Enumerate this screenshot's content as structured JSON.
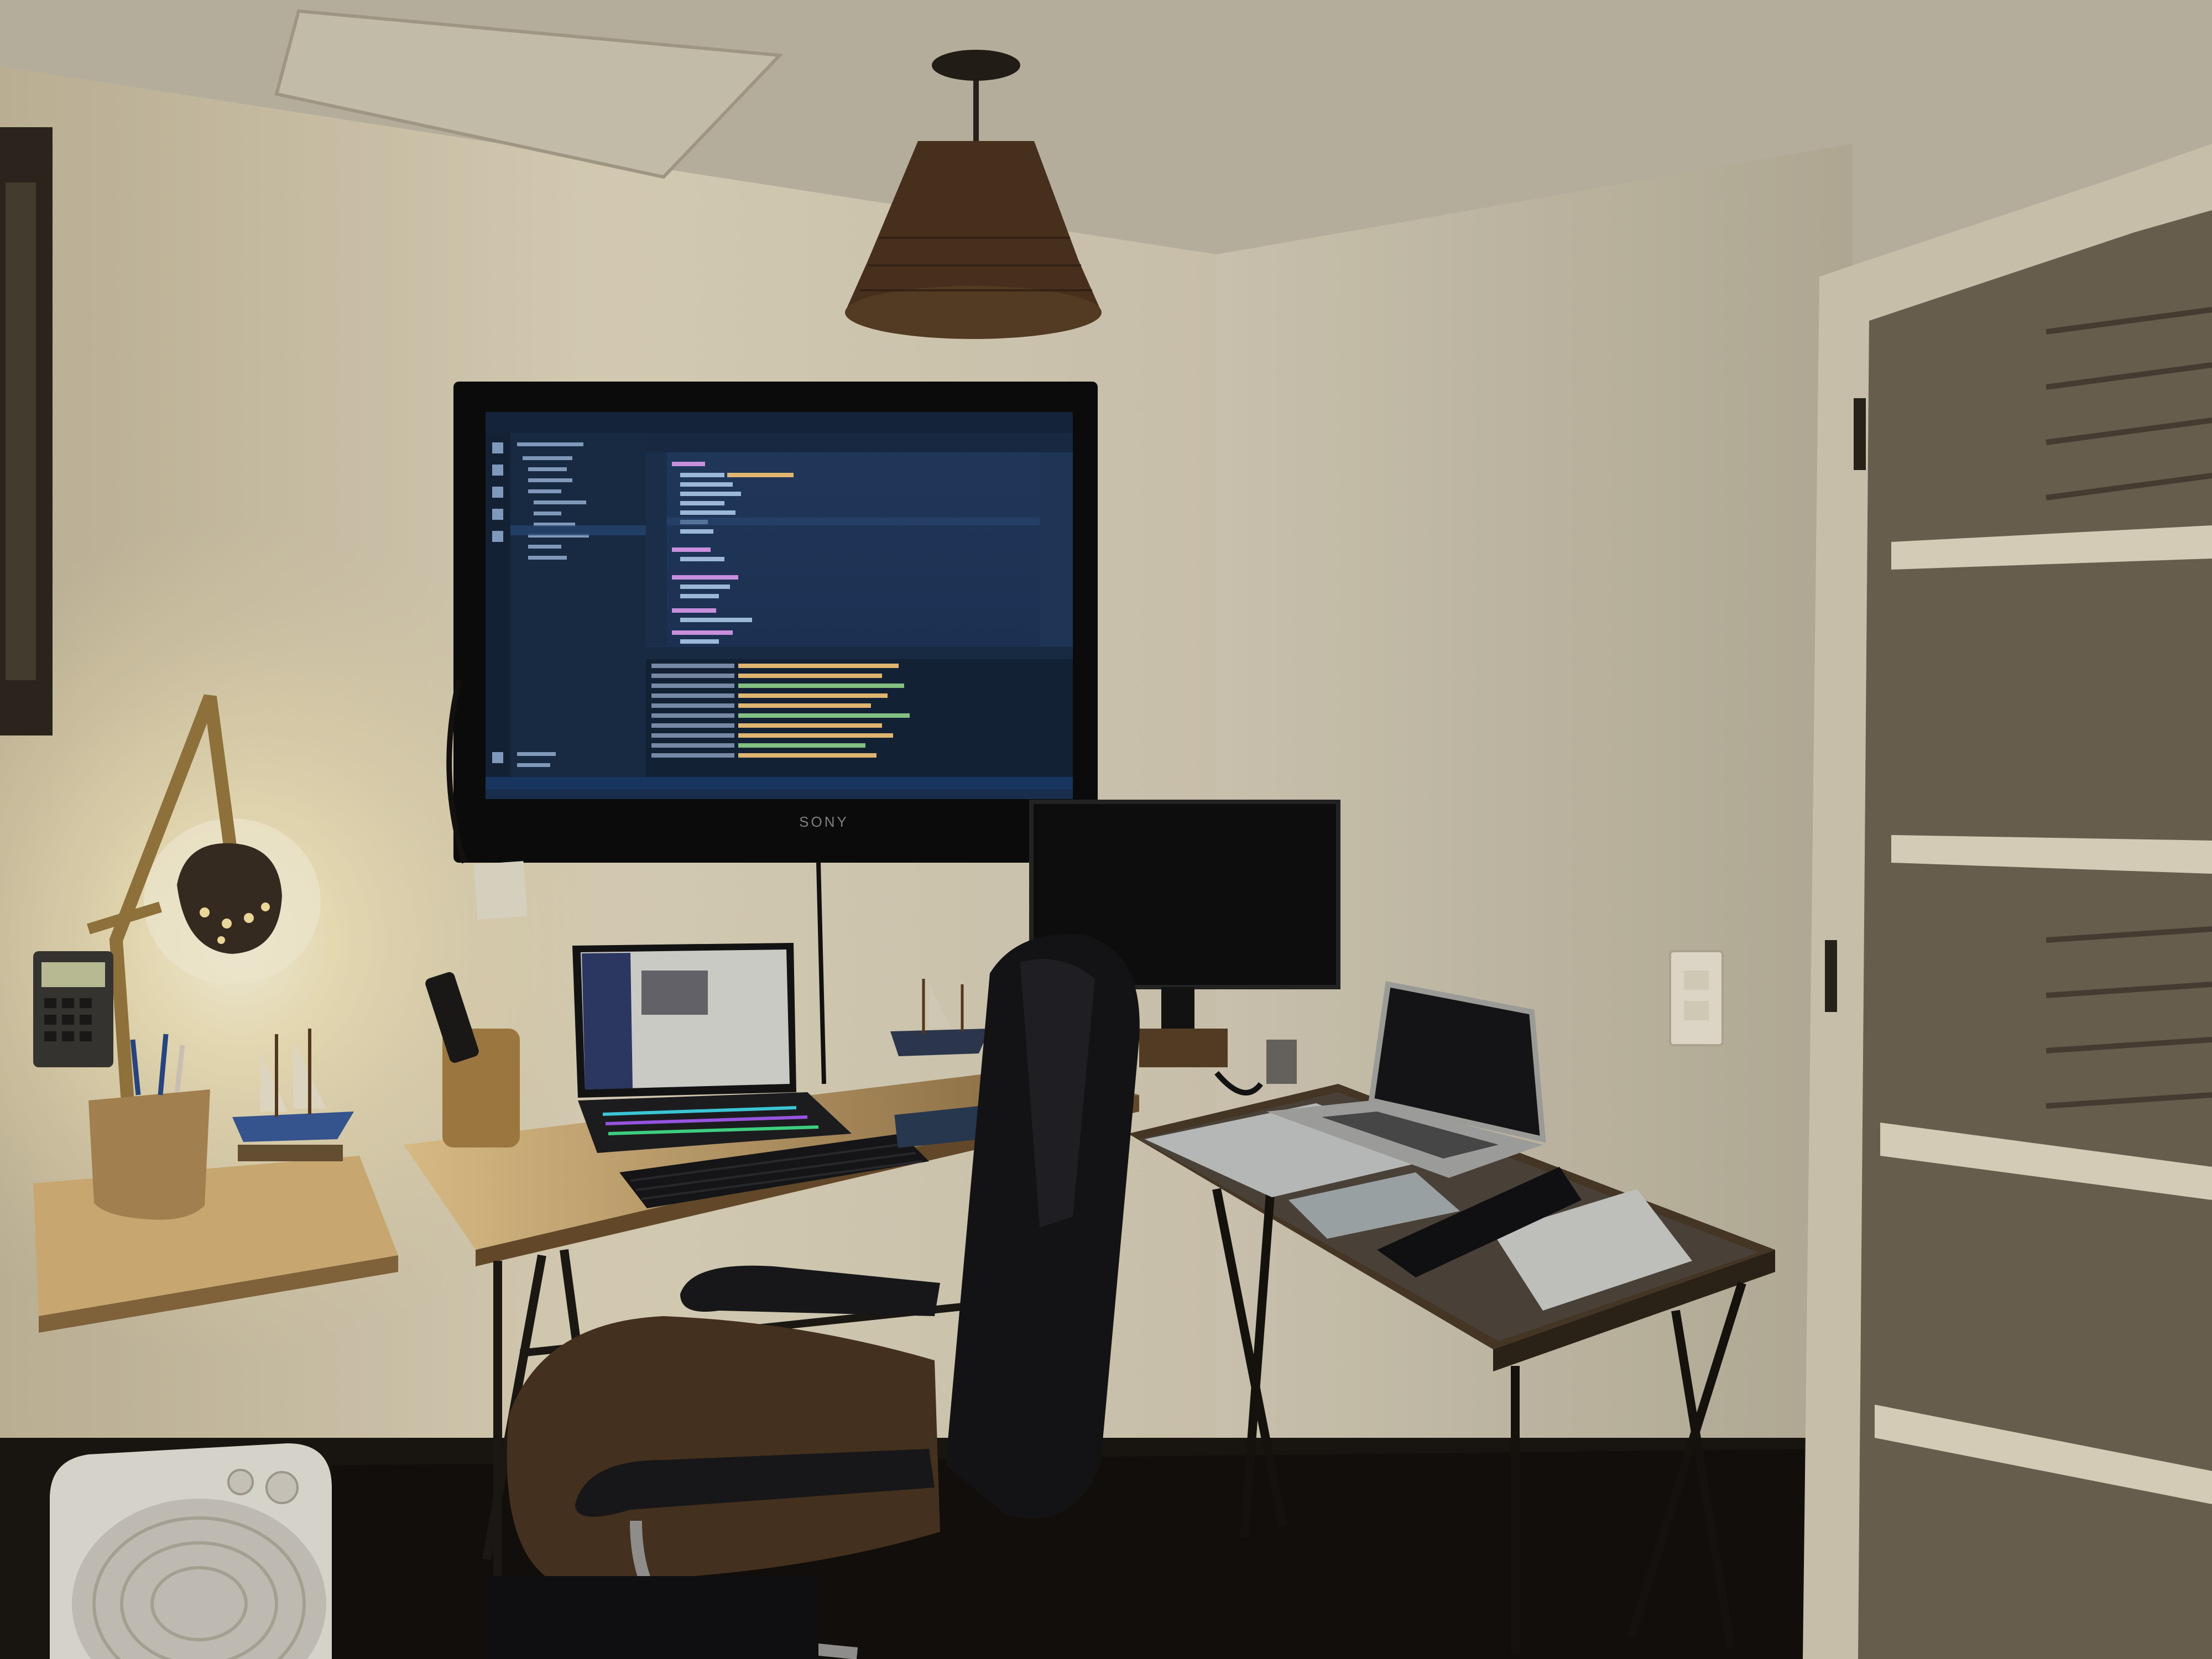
{
  "scene": {
    "kind": "photo",
    "setting": "home-office-at-night"
  },
  "tv": {
    "brand_label": "SONY"
  },
  "editor_theme": {
    "background": "#1f3658",
    "sidebar": "#1b2d48",
    "terminal": "#15243a",
    "keyword": "#d99cf0",
    "string": "#f2c57a",
    "text": "#a9c8ec",
    "accent": "#4fa3ff"
  },
  "palette": {
    "wall_lit": "#e9dfc3",
    "wall_shadow": "#b7ad96",
    "ceiling": "#c7bfae",
    "desk_wood": "#c9a46d",
    "floor": "#1c1812",
    "lamp_glow": "#fff4cf"
  }
}
